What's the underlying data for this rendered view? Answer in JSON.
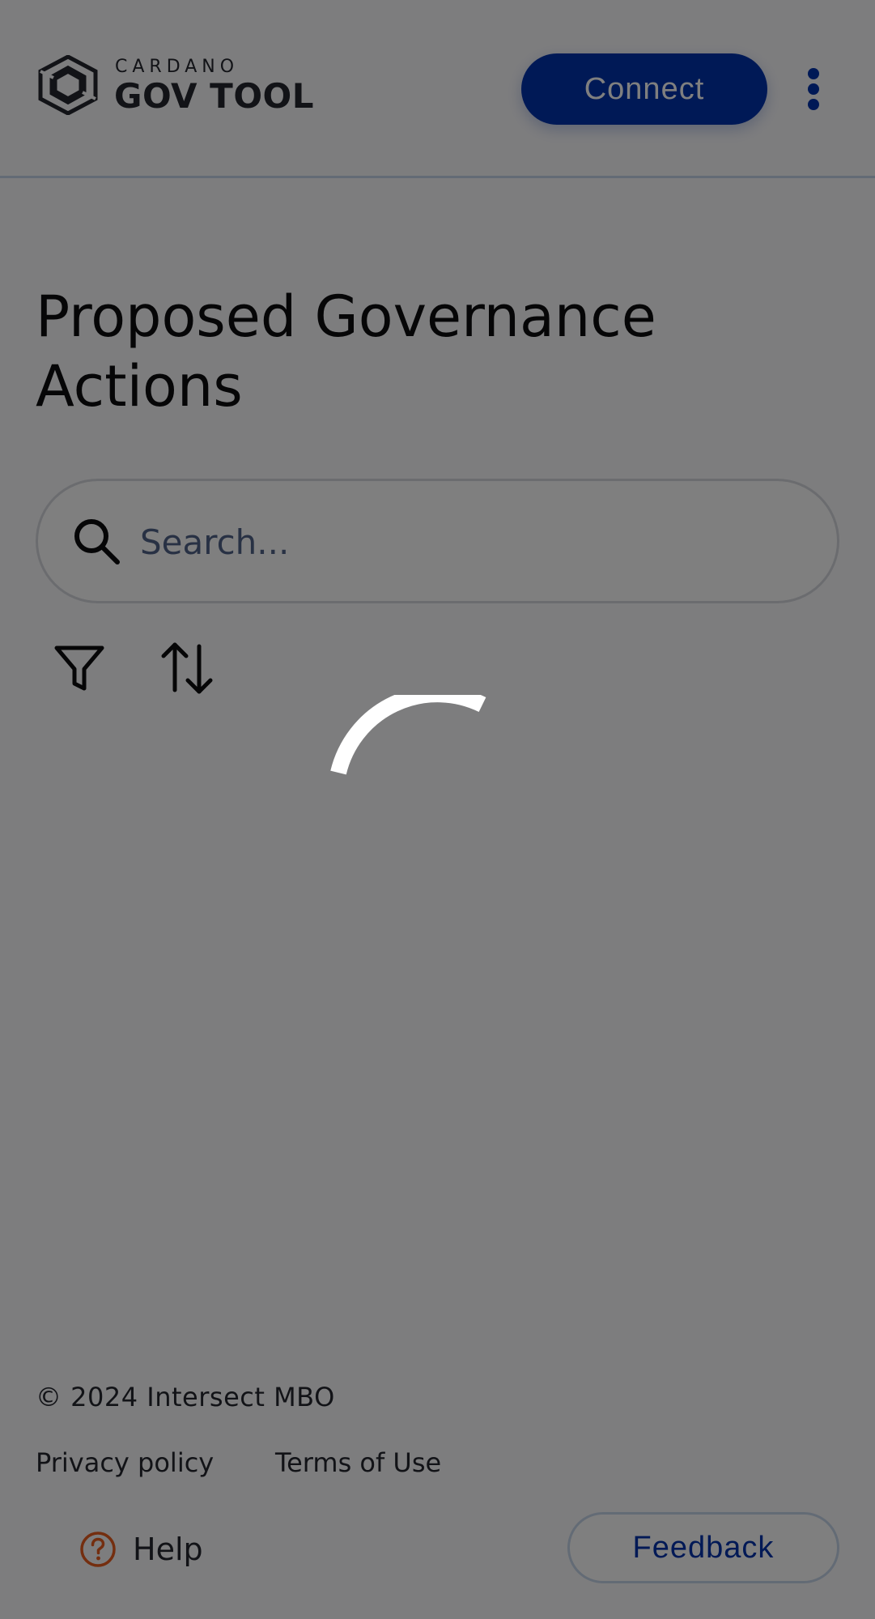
{
  "header": {
    "logo_small": "CARDANO",
    "logo_big": "GOV TOOL",
    "connect_label": "Connect",
    "menu_icon": "more-vertical-icon"
  },
  "main": {
    "title": "Proposed Governance Actions",
    "search": {
      "placeholder": "Search...",
      "value": ""
    },
    "filter_icon": "filter-icon",
    "sort_icon": "sort-icon"
  },
  "footer": {
    "copyright": "© 2024 Intersect MBO",
    "privacy_label": "Privacy policy",
    "terms_label": "Terms of Use",
    "help_label": "Help",
    "feedback_label": "Feedback"
  },
  "loading": {
    "visible": true,
    "spinner_icon": "loading-spinner-icon"
  },
  "colors": {
    "primary": "#0033ad",
    "text": "#24262e",
    "help_accent": "#e85c1f",
    "overlay": "rgba(0,0,0,0.5)"
  }
}
